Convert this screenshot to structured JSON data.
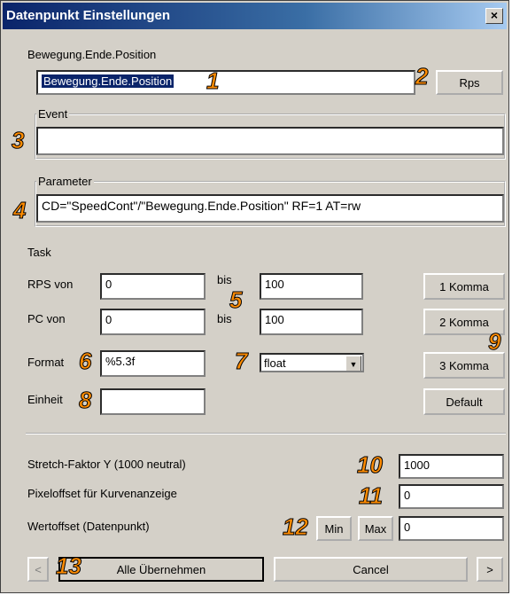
{
  "window": {
    "title": "Datenpunkt Einstellungen",
    "close": "×"
  },
  "name": {
    "label": "Bewegung.Ende.Position",
    "value": "Bewegung.Ende.Position",
    "rps_button": "Rps"
  },
  "event": {
    "legend": "Event",
    "value": ""
  },
  "parameter": {
    "legend": "Parameter",
    "value": "CD=\"SpeedCont\"/\"Bewegung.Ende.Position\" RF=1 AT=rw"
  },
  "task": {
    "title": "Task",
    "rps_von_label": "RPS von",
    "rps_von_value": "0",
    "bis1_label": "bis",
    "bis1_value": "100",
    "pc_von_label": "PC von",
    "pc_von_value": "0",
    "bis2_label": "bis",
    "bis2_value": "100",
    "format_label": "Format",
    "format_value": "%5.3f",
    "type_value": "float",
    "einheit_label": "Einheit",
    "einheit_value": "",
    "komma1": "1 Komma",
    "komma2": "2 Komma",
    "komma3": "3 Komma",
    "default": "Default"
  },
  "bottom": {
    "stretch_label": "Stretch-Faktor Y (1000 neutral)",
    "stretch_value": "1000",
    "pixeloffset_label": "Pixeloffset für Kurvenanzeige",
    "pixeloffset_value": "0",
    "wertoffset_label": "Wertoffset (Datenpunkt)",
    "wertoffset_value": "0",
    "min_button": "Min",
    "max_button": "Max"
  },
  "actions": {
    "prev": "<",
    "apply_all": "Alle Übernehmen",
    "cancel": "Cancel",
    "next": ">"
  },
  "callouts": [
    "1",
    "2",
    "3",
    "4",
    "5",
    "6",
    "7",
    "8",
    "9",
    "10",
    "11",
    "12",
    "13"
  ]
}
